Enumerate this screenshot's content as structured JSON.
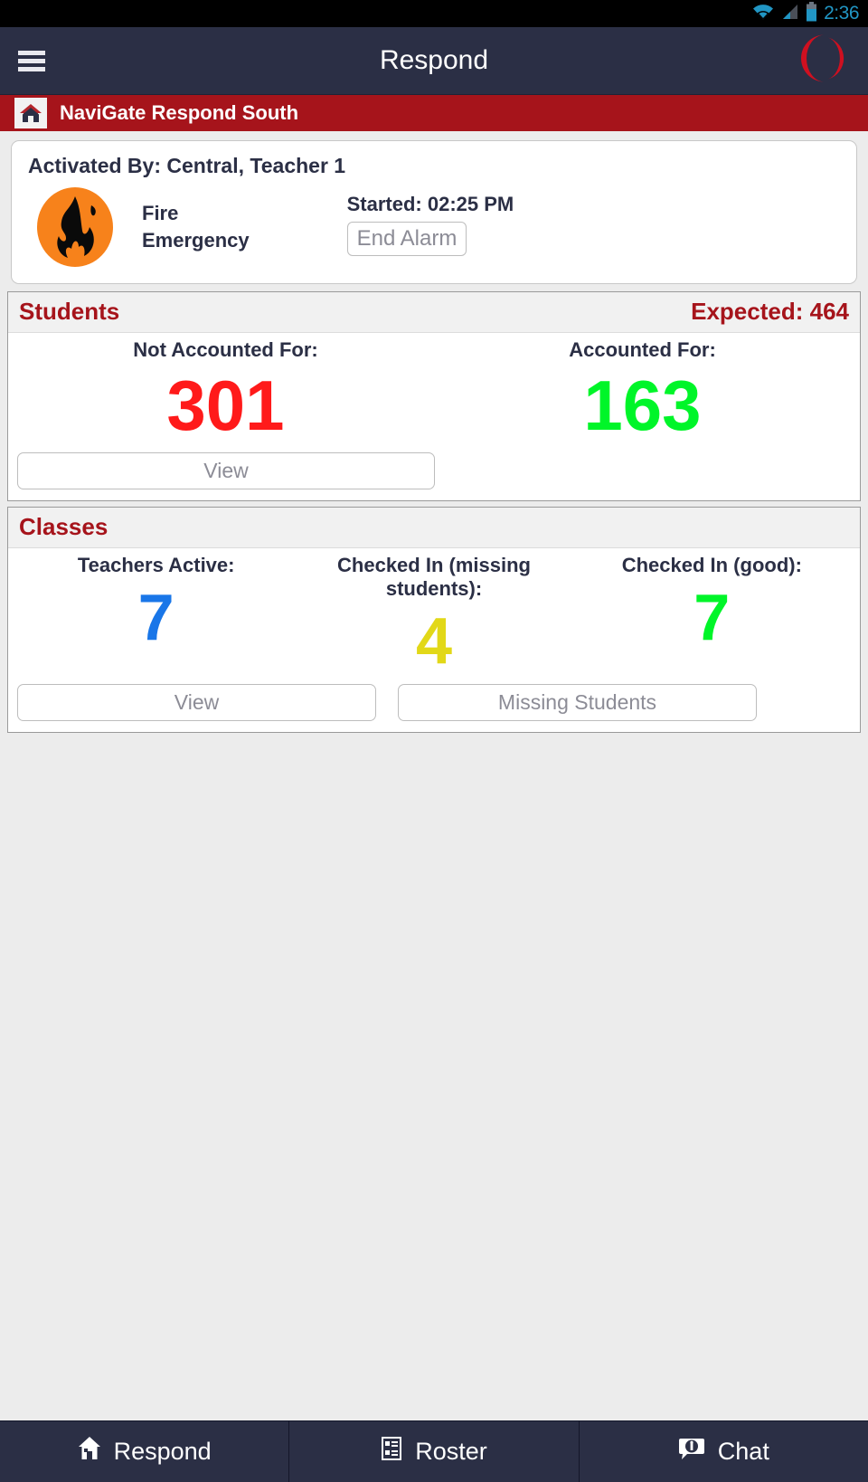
{
  "statusbar": {
    "time": "2:36",
    "icons": [
      "wifi-icon",
      "cellular-signal-icon",
      "battery-icon"
    ]
  },
  "appbar": {
    "menu_icon": "hamburger-menu-icon",
    "title": "Respond",
    "logo_icon": "navigate-brand-logo"
  },
  "schoolbar": {
    "home_icon": "home-icon",
    "title": "NaviGate Respond South"
  },
  "alarm": {
    "activated_by": "Activated By: Central, Teacher 1",
    "type_icon": "fire-emergency-icon",
    "type_line1": "Fire",
    "type_line2": "Emergency",
    "started": "Started: 02:25 PM",
    "end_alarm_label": "End Alarm"
  },
  "students": {
    "title": "Students",
    "expected": "Expected: 464",
    "not_accounted_label": "Not Accounted For:",
    "not_accounted_value": "301",
    "not_accounted_color": "#ff1a1a",
    "accounted_label": "Accounted For:",
    "accounted_value": "163",
    "accounted_color": "#00f529",
    "view_label": "View"
  },
  "classes": {
    "title": "Classes",
    "teachers_active_label": "Teachers Active:",
    "teachers_active_value": "7",
    "teachers_active_color": "#1976e8",
    "checked_in_missing_label": "Checked In (missing students):",
    "checked_in_missing_value": "4",
    "checked_in_missing_color": "#e2d818",
    "checked_in_good_label": "Checked In (good):",
    "checked_in_good_value": "7",
    "checked_in_good_color": "#00f529",
    "view_label": "View",
    "missing_students_label": "Missing Students"
  },
  "bottomnav": {
    "items": [
      {
        "label": "Respond",
        "icon": "house-icon"
      },
      {
        "label": "Roster",
        "icon": "roster-list-icon"
      },
      {
        "label": "Chat",
        "icon": "chat-bubble-icon"
      }
    ]
  },
  "colors": {
    "brand_red": "#a6141b",
    "navy": "#2b2f45",
    "status_blue": "#2196c4"
  }
}
